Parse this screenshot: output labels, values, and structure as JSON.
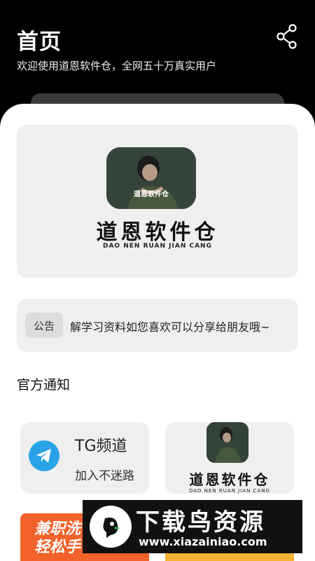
{
  "header": {
    "title": "首页",
    "subtitle": "欢迎使用道恩软件仓，全网五十万真实用户",
    "share_icon": "share-icon"
  },
  "banner": {
    "title": "道恩软件仓",
    "pinyin": "DAO NEN  RUAN JIAN CANG",
    "photo_caption": "道恩软件仓"
  },
  "notice": {
    "tag": "公告",
    "text": "解学习资料如您喜欢可以分享给朋友哦~"
  },
  "section": {
    "title": "官方通知"
  },
  "cards": {
    "tg": {
      "title": "TG频道",
      "subtitle": "加入不迷路",
      "icon": "telegram-icon",
      "color": "#2aa3e6"
    },
    "app": {
      "title": "道恩软件仓",
      "pinyin": "DAO NEN  RUAN JIAN CANG"
    }
  },
  "promos": {
    "left_text": "兼职洗\n轻松手",
    "left_color": "#f2622a",
    "right_color": "#f5b332"
  },
  "watermark": {
    "title": "下载鸟资源",
    "url": "www.xiazainiao.com"
  }
}
